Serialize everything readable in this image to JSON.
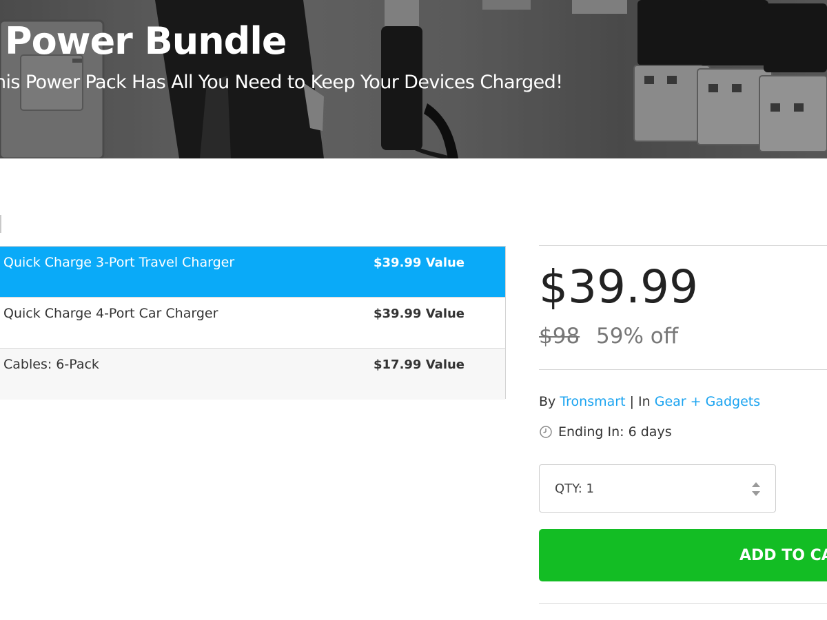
{
  "hero": {
    "title": "Power Bundle",
    "subtitle": "his Power Pack Has All You Need to Keep Your Devices Charged!"
  },
  "bundle": {
    "items": [
      {
        "name": "Quick Charge 3-Port Travel Charger",
        "value": "$39.99 Value",
        "selected": true
      },
      {
        "name": "Quick Charge 4-Port Car Charger",
        "value": "$39.99 Value",
        "selected": false
      },
      {
        "name": "Cables: 6-Pack",
        "value": "$17.99 Value",
        "selected": false
      }
    ]
  },
  "pricing": {
    "price": "$39.99",
    "original_price": "$98",
    "discount": "59% off"
  },
  "meta": {
    "by_label": "By",
    "vendor": "Tronsmart",
    "separator": "|",
    "in_label": "In",
    "category": "Gear + Gadgets",
    "ending": "Ending In: 6 days"
  },
  "quantity": {
    "label": "QTY: 1"
  },
  "cart": {
    "button_label": "ADD TO CA"
  },
  "colors": {
    "selected_row": "#0aaaf8",
    "link": "#1aa3f0",
    "cart_button": "#13bd24"
  },
  "icons": {
    "ending": "clock-icon",
    "quantity": "stepper-arrows-icon"
  }
}
